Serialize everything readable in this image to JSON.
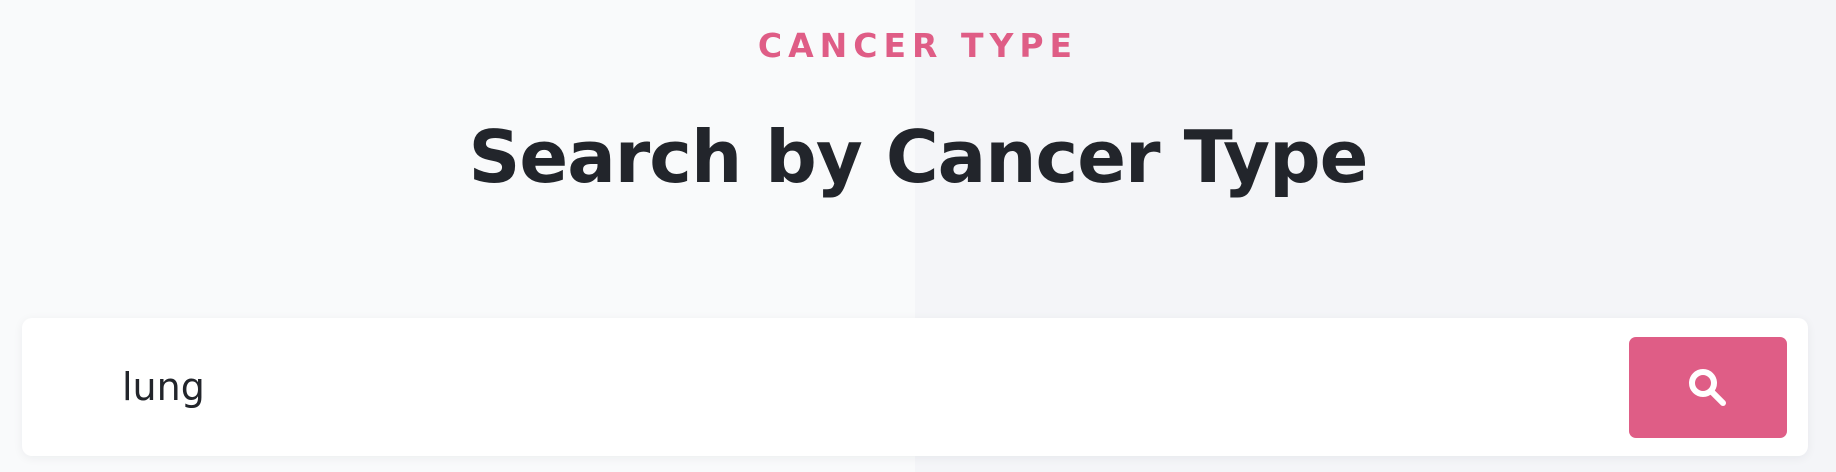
{
  "section": {
    "eyebrow": "CANCER TYPE",
    "heading": "Search by Cancer Type"
  },
  "search": {
    "value": "lung",
    "button_icon": "search-icon"
  },
  "colors": {
    "accent": "#df5d86",
    "heading": "#22252b",
    "background_left": "#f9fafb",
    "background_right": "#f4f5f8",
    "card": "#ffffff"
  }
}
